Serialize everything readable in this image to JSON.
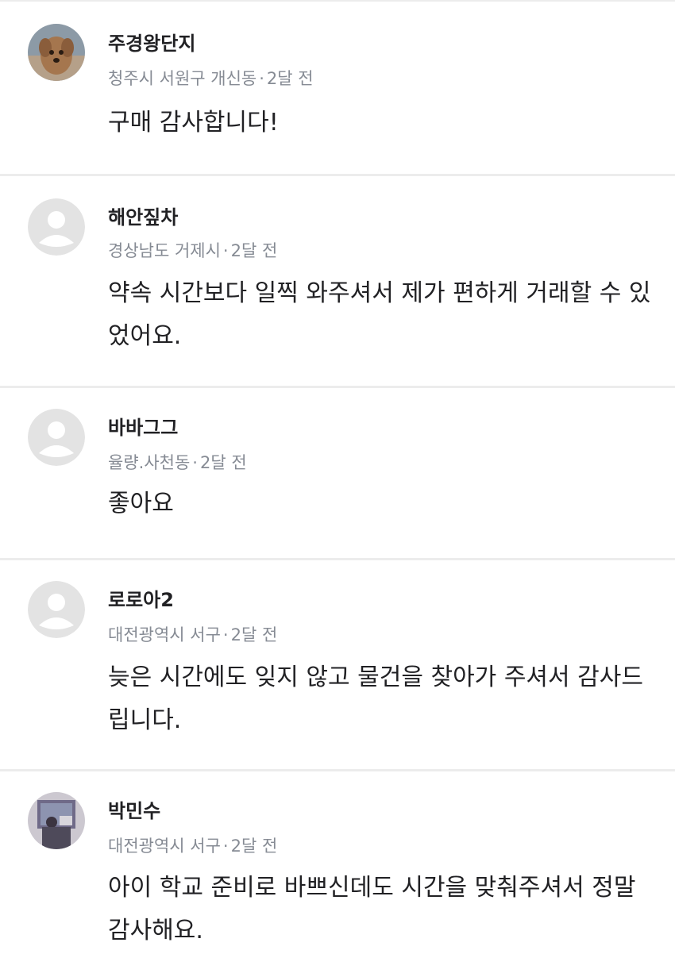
{
  "reviews": [
    {
      "nickname": "주경왕단지",
      "location": "청주시 서원구 개신동",
      "time": "2달 전",
      "text": "구매 감사합니다!",
      "avatar": "dog-photo-avatar"
    },
    {
      "nickname": "해안짚차",
      "location": "경상남도 거제시",
      "time": "2달 전",
      "text": "약속 시간보다 일찍 와주셔서 제가 편하게 거래할 수 있었어요.",
      "avatar": "default-profile-avatar"
    },
    {
      "nickname": "바바그그",
      "location": "율량.사천동",
      "time": "2달 전",
      "text": "좋아요",
      "avatar": "default-profile-avatar"
    },
    {
      "nickname": "로로아2",
      "location": "대전광역시 서구",
      "time": "2달 전",
      "text": "늦은 시간에도 잊지 않고 물건을 찾아가 주셔서 감사드립니다.",
      "avatar": "default-profile-avatar"
    },
    {
      "nickname": "박민수",
      "location": "대전광역시 서구",
      "time": "2달 전",
      "text": "아이 학교 준비로 바쁘신데도 시간을 맞춰주셔서 정말 감사해요.",
      "avatar": "person-photo-avatar"
    }
  ],
  "meta_separator": "·",
  "colors": {
    "nickname": "#212124",
    "meta": "#868b94",
    "body": "#212124",
    "divider": "#ececec",
    "default_avatar_bg": "#e3e3e3"
  }
}
